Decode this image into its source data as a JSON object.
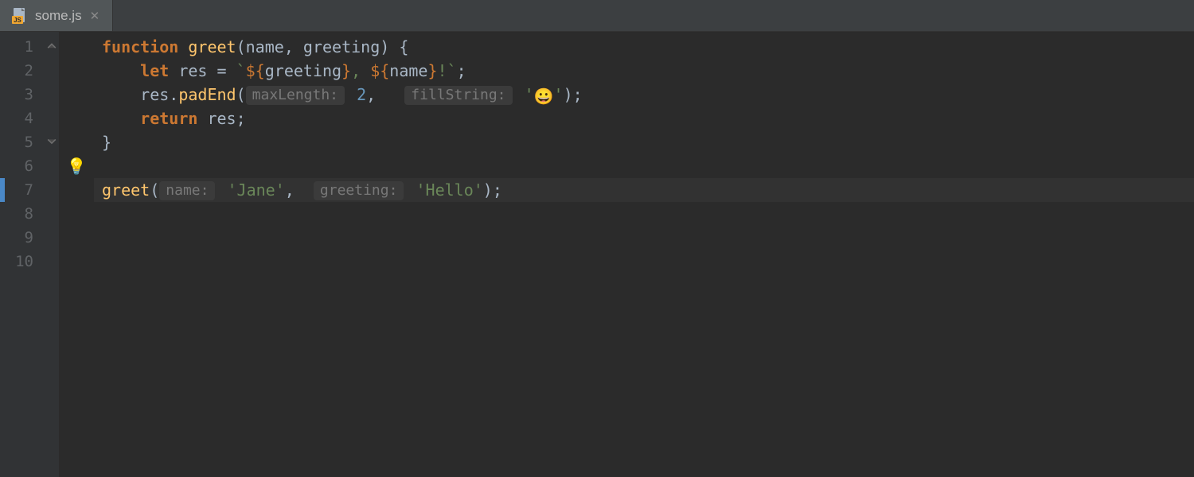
{
  "tab": {
    "filename": "some.js",
    "close_glyph": "✕"
  },
  "gutter": {
    "lines": [
      "1",
      "2",
      "3",
      "4",
      "5",
      "6",
      "7",
      "8",
      "9",
      "10"
    ]
  },
  "icons": {
    "bulb": "💡",
    "emoji_grin": "😀"
  },
  "code": {
    "current_line_index": 6,
    "line1": {
      "kw_function": "function",
      "fn_name": "greet",
      "params_open": "(",
      "param1": "name",
      "comma": ", ",
      "param2": "greeting",
      "params_close": ")",
      "brace_open": " {"
    },
    "line2": {
      "indent": "    ",
      "kw_let": "let",
      "var": "res",
      "eq": " = ",
      "bt_open": "`",
      "tmpl1_open": "${",
      "tmpl1_id": "greeting",
      "tmpl1_close": "}",
      "str_mid": ", ",
      "tmpl2_open": "${",
      "tmpl2_id": "name",
      "tmpl2_close": "}",
      "str_end": "!",
      "bt_close": "`",
      "semi": ";"
    },
    "line3": {
      "indent": "    ",
      "obj": "res",
      "dot": ".",
      "method": "padEnd",
      "paren_open": "(",
      "hint1": "maxLength:",
      "arg1": "2",
      "comma": ", ",
      "hint2": "fillString:",
      "str_open": "'",
      "str_close": "'",
      "paren_close": ")",
      "semi": ";"
    },
    "line4": {
      "indent": "    ",
      "kw_return": "return",
      "sp": " ",
      "var": "res",
      "semi": ";"
    },
    "line5": {
      "brace_close": "}"
    },
    "line7": {
      "fn": "greet",
      "paren_open": "(",
      "hint1": "name:",
      "str1": "'Jane'",
      "comma": ", ",
      "hint2": "greeting:",
      "str2": "'Hello'",
      "paren_close": ")",
      "semi": ";"
    }
  }
}
